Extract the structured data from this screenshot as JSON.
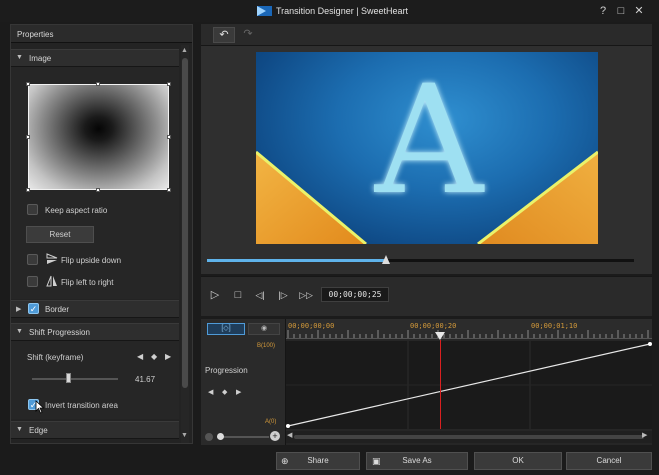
{
  "window": {
    "title": "Transition Designer | SweetHeart",
    "help": "?",
    "maximize": "□",
    "close": "✕"
  },
  "properties": {
    "title": "Properties",
    "image": {
      "label": "Image",
      "keep_aspect_ratio": "Keep aspect ratio",
      "reset": "Reset",
      "flip_upside_down": "Flip upside down",
      "flip_left_to_right": "Flip left to right"
    },
    "border": {
      "label": "Border",
      "checked": true
    },
    "shift_progression": {
      "label": "Shift Progression",
      "shift_keyframe": "Shift (keyframe)",
      "value": "41.67",
      "slider_fraction": 0.42,
      "invert_transition_area": "Invert transition area",
      "invert_checked": true
    },
    "edge": {
      "label": "Edge"
    }
  },
  "toolbar": {
    "undo": "↶",
    "redo": "↷"
  },
  "preview": {
    "letter": "A",
    "progress_fraction": 0.42,
    "accent": "#5fb3ea"
  },
  "controls": {
    "play": "▷",
    "stop": "□",
    "prev": "◁|",
    "next": "|▷",
    "fast_forward": "▷▷",
    "timecode": "00;00;00;25"
  },
  "timeline": {
    "ruler": [
      "00;00;00;00",
      "00;00;00;20",
      "00;00;01;10"
    ],
    "playhead_fraction": 0.42,
    "track_label": "Progression",
    "y_max": "B(100)",
    "y_min": "A(0)"
  },
  "buttons": {
    "share": "Share",
    "save_as": "Save As",
    "ok": "OK",
    "cancel": "Cancel"
  }
}
